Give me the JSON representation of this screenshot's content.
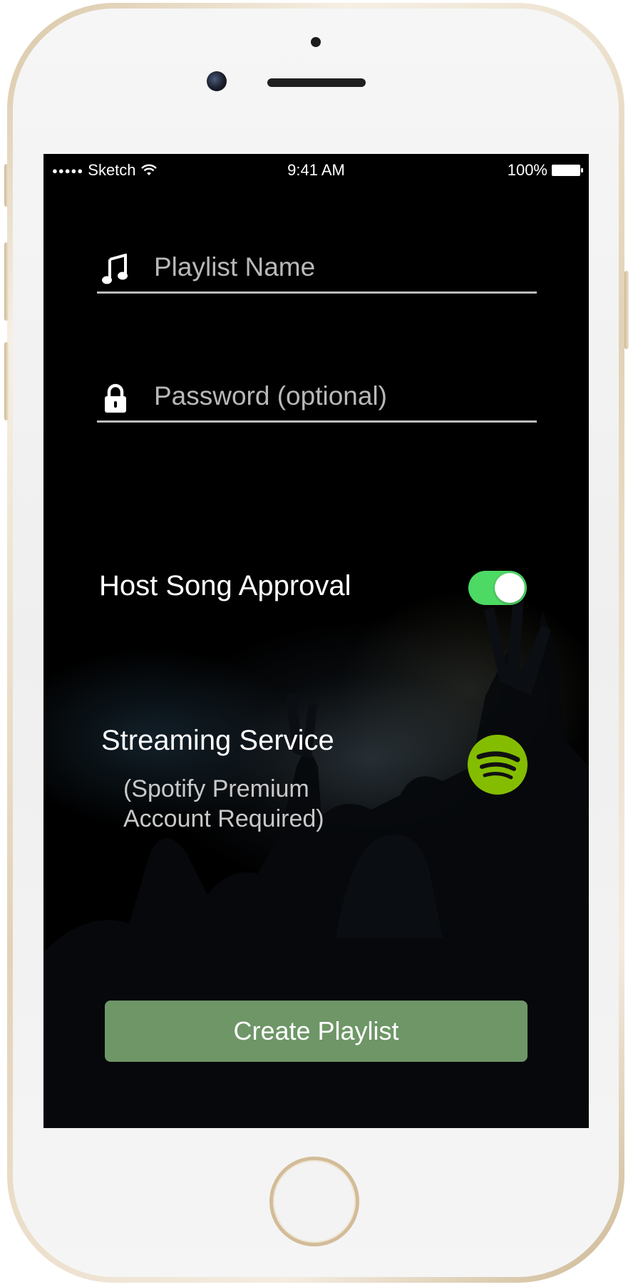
{
  "status_bar": {
    "signal": "●●●●●",
    "carrier": "Sketch",
    "wifi_icon": "wifi-icon",
    "time": "9:41 AM",
    "battery_text": "100%",
    "battery_icon": "battery-icon"
  },
  "form": {
    "playlist_name": {
      "icon": "music-note-icon",
      "placeholder": "Playlist Name",
      "value": ""
    },
    "password": {
      "icon": "lock-icon",
      "placeholder": "Password (optional)",
      "value": ""
    }
  },
  "host_song_approval": {
    "label": "Host Song Approval",
    "enabled": true,
    "on_color": "#4cd964"
  },
  "streaming_service": {
    "label": "Streaming Service",
    "note_line1": "(Spotify Premium",
    "note_line2": "Account Required)",
    "icon": "spotify-icon",
    "icon_color": "#84bd00"
  },
  "create_button": {
    "label": "Create Playlist",
    "color": "#6e9667"
  },
  "device": {
    "home_button_icon": "home-button-icon"
  }
}
